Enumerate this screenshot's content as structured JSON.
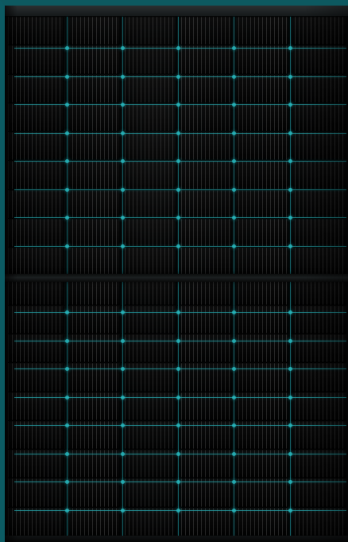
{
  "scene": {
    "subject": "solar-panel",
    "frame_color": "#0c5b63",
    "cell_color": "#151819",
    "highlight_color": "#8f9494",
    "busbar_color": "#26aab1",
    "columns": 6,
    "rows": 18,
    "sections": 2
  }
}
